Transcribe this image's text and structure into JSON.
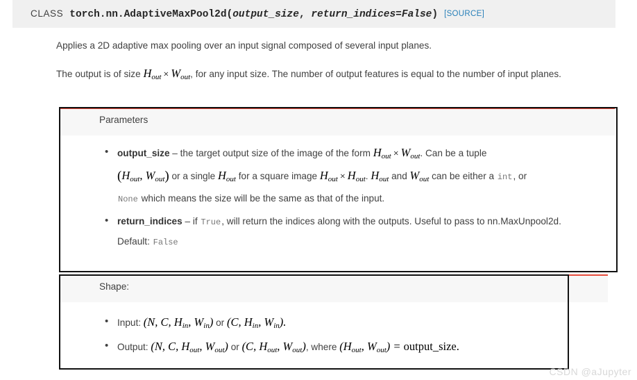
{
  "signature": {
    "class_keyword": "CLASS",
    "qualname": "torch.nn.AdaptiveMaxPool2d",
    "open_paren": "(",
    "arg1": "output_size",
    "comma": ", ",
    "arg2": "return_indices=False",
    "close_paren": ")",
    "source_link": "[SOURCE]"
  },
  "description": {
    "paragraph_1": "Applies a 2D adaptive max pooling over an input signal composed of several input planes.",
    "paragraph_2_a": "The output is of size ",
    "paragraph_2_math_h": "H",
    "paragraph_2_math_h_sub": "out",
    "paragraph_2_times": "×",
    "paragraph_2_math_w": "W",
    "paragraph_2_math_w_sub": "out",
    "paragraph_2_b": ", for any input size. The number of output features is equal to the number of input planes."
  },
  "parameters_box": {
    "heading": "Parameters",
    "items": [
      {
        "name": "output_size",
        "dash": " – ",
        "text_a": "the target output size of the image of the form ",
        "math_h": "H",
        "sub_out": "out",
        "times": "×",
        "math_w": "W",
        "text_b": ". Can be a tuple ",
        "text_c": " or a single ",
        "text_d": " for a square image ",
        "text_e": ". ",
        "text_f": " and ",
        "text_g": " can be either a ",
        "code_int": "int",
        "text_h": ", or ",
        "code_none": "None",
        "text_i": " which means the size will be the same as that of the input."
      },
      {
        "name": "return_indices",
        "dash": " – ",
        "text_a": "if ",
        "code_true": "True",
        "text_b": ", will return the indices along with the outputs. Useful to pass to nn.MaxUnpool2d.",
        "default_label": "Default: ",
        "default_value": "False"
      }
    ]
  },
  "shape_box": {
    "heading": "Shape:",
    "items": [
      {
        "label": "Input: ",
        "math_1": "(N, C, H",
        "sub_1": "in",
        "math_2": ", W",
        "sub_2": "in",
        "math_3": ")",
        "or": " or ",
        "math_4": "(C, H",
        "sub_3": "in",
        "math_5": ", W",
        "sub_4": "in",
        "math_6": ")."
      },
      {
        "label": "Output: ",
        "math_1": "(N, C, H",
        "sub_1": "out",
        "math_2": ", W",
        "sub_2": "out",
        "math_3": ")",
        "or": " or ",
        "math_4": "(C, H",
        "sub_3": "out",
        "math_5": ", W",
        "sub_4": "out",
        "math_6": ")",
        "where": ", where ",
        "math_7": "(H",
        "sub_5": "out",
        "math_8": ", W",
        "sub_6": "out",
        "math_9": ") = ",
        "result": "output_size."
      }
    ]
  },
  "watermark": {
    "text": "CSDN @aJupyter"
  },
  "colors": {
    "accent_red": "#e74c3c",
    "link_blue": "#2980b9",
    "header_band": "#f0f0f0",
    "field_header": "#f7f7f7",
    "annotation": "#111111",
    "body_text": "#404040",
    "code_gray": "#777777"
  }
}
